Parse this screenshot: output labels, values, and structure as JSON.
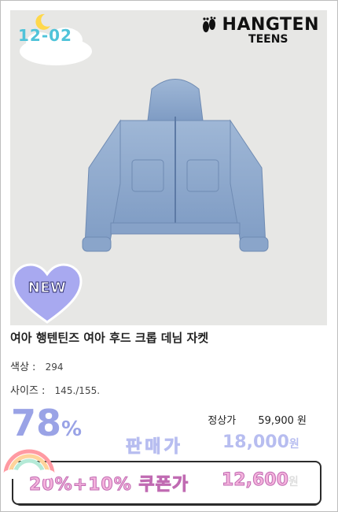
{
  "date_badge": "12-02",
  "brand": {
    "name": "HANGTEN",
    "sub": "TEENS"
  },
  "badge_new": "NEW",
  "product": {
    "title": "여아 행텐틴즈 여아 후드 크롭 데님 자켓",
    "color_label": "색상 :",
    "color_value": "294",
    "size_label": "사이즈 :",
    "size_value": "145./155."
  },
  "pricing": {
    "discount_number": "78",
    "discount_symbol": "%",
    "regular_label": "정상가",
    "regular_price": "59,900",
    "regular_currency": "원",
    "sale_label": "판매가",
    "sale_price": "18,000",
    "sale_currency": "원",
    "coupon_label": "20%+10% 쿠폰가",
    "coupon_price": "12,600",
    "coupon_currency": "원"
  },
  "colors": {
    "accent": "#9aa3e6",
    "coupon": "#f4b3dc",
    "date": "#4fc3d9"
  },
  "icons": [
    "moon-icon",
    "cloud-icon",
    "footprints-icon",
    "heart-badge-icon",
    "rainbow-icon",
    "jacket-image"
  ]
}
